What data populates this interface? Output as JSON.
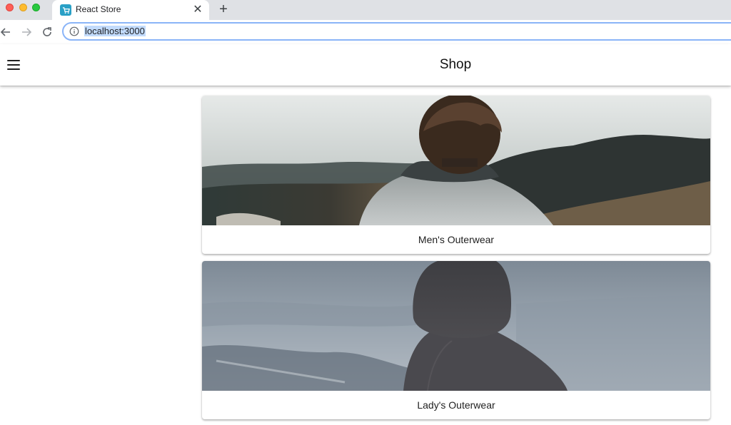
{
  "browser": {
    "tab": {
      "title": "React Store",
      "close_glyph": "✕",
      "favicon": "cart-icon"
    },
    "new_tab_glyph": "+",
    "address_bar": {
      "url": "localhost:3000",
      "icon": "info-icon"
    },
    "nav": {
      "back": "arrow-left-icon",
      "forward": "arrow-right-icon",
      "reload": "reload-icon"
    }
  },
  "app": {
    "title": "Shop",
    "menu_icon": "hamburger-menu-icon",
    "categories": [
      {
        "label": "Men's Outerwear"
      },
      {
        "label": "Lady's Outerwear"
      }
    ]
  },
  "colors": {
    "tab_strip": "#dfe1e5",
    "url_highlight": "#c2dbfc",
    "omnibox_border": "#8ab4f8",
    "favicon": "#2aa0c6"
  }
}
